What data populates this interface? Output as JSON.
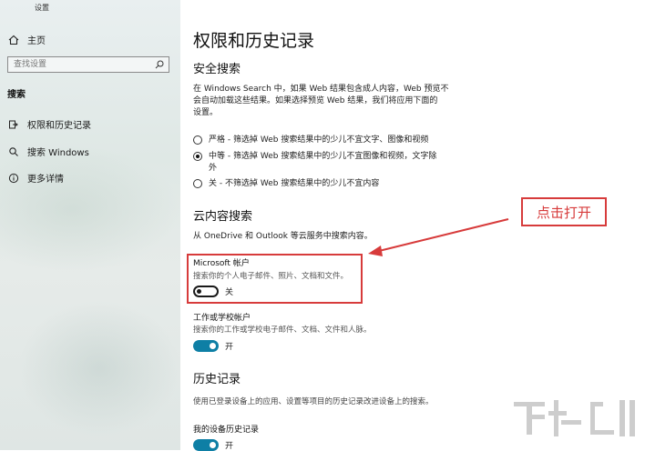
{
  "window": {
    "title": "设置"
  },
  "sidebar": {
    "home": "主页",
    "search_placeholder": "查找设置",
    "section": "搜索",
    "items": [
      {
        "label": "权限和历史记录",
        "icon": "permissions-icon"
      },
      {
        "label": "搜索 Windows",
        "icon": "search-icon"
      },
      {
        "label": "更多详情",
        "icon": "info-icon"
      }
    ]
  },
  "main": {
    "title": "权限和历史记录",
    "safe_search": {
      "heading": "安全搜索",
      "desc_line1": "在 Windows Search 中，如果 Web 结果包含成人内容，Web 预览不",
      "desc_line2": "会自动加载这些结果。如果选择预览 Web 结果，我们将应用下面的",
      "desc_line3": "设置。",
      "options": [
        {
          "line1": "严格 - 筛选掉 Web 搜索结果中的少儿不宜文字、图像和视频",
          "line2": "",
          "selected": false
        },
        {
          "line1": "中等 - 筛选掉 Web 搜索结果中的少儿不宜图像和视频，文字除",
          "line2": "外",
          "selected": true
        },
        {
          "line1": "关 - 不筛选掉 Web 搜索结果中的少儿不宜内容",
          "line2": "",
          "selected": false
        }
      ]
    },
    "cloud_search": {
      "heading": "云内容搜索",
      "desc": "从 OneDrive 和 Outlook 等云服务中搜索内容。",
      "microsoft_account": {
        "title": "Microsoft 帐户",
        "desc": "搜索你的个人电子邮件、照片、文档和文件。",
        "state_label": "关",
        "on": false
      },
      "work_account": {
        "title": "工作或学校帐户",
        "desc": "搜索你的工作或学校电子邮件、文档、文件和人脉。",
        "state_label": "开",
        "on": true
      }
    },
    "history": {
      "heading": "历史记录",
      "desc": "使用已登录设备上的应用、设置等项目的历史记录改进设备上的搜索。",
      "device_history": {
        "title": "我的设备历史记录",
        "state_label": "开",
        "on": true
      }
    }
  },
  "annotation": {
    "callout_text": "点击打开",
    "color": "#d73b3b"
  },
  "colors": {
    "toggle_on": "#0e7fa5"
  }
}
